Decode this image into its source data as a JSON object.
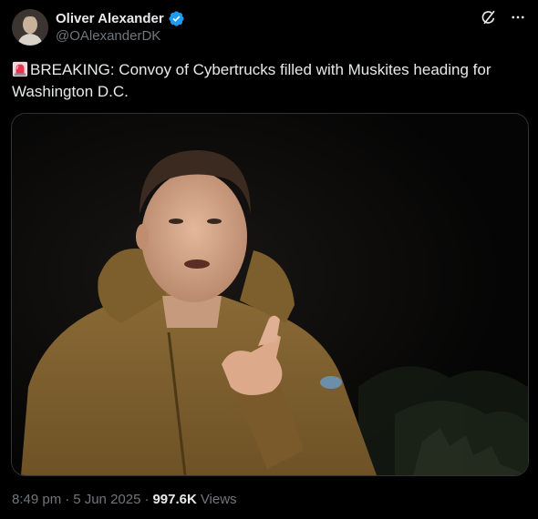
{
  "author": {
    "display_name": "Oliver Alexander",
    "handle": "@OAlexanderDK",
    "verified": true
  },
  "header_icons": [
    "grok-icon",
    "more-icon"
  ],
  "tweet": {
    "emoji": "police-light-icon",
    "text": "BREAKING: Convoy of Cybertrucks filled with Muskites heading for Washington D.C."
  },
  "media": {
    "type": "photo"
  },
  "meta": {
    "time": "8:49 pm",
    "date": "5 Jun 2025",
    "separator": "·",
    "views_count": "997.6K",
    "views_label": "Views"
  },
  "colors": {
    "background": "#000000",
    "text": "#e7e9ea",
    "secondary": "#71767b",
    "verified": "#1d9bf0",
    "border": "#2f3336"
  }
}
